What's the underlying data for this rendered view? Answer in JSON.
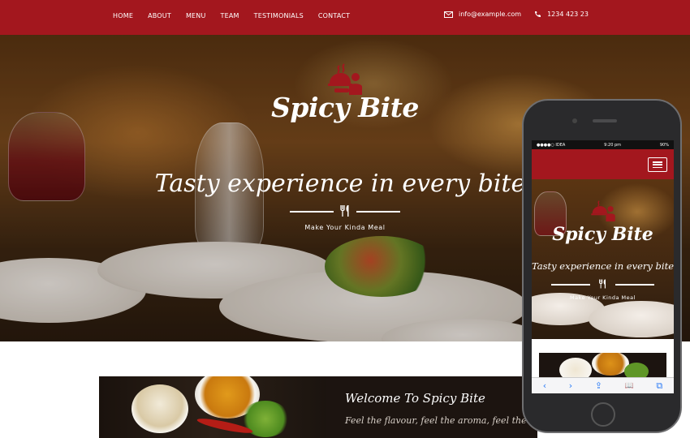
{
  "nav": {
    "links": [
      "HOME",
      "ABOUT",
      "MENU",
      "TEAM",
      "TESTIMONIALS",
      "CONTACT"
    ],
    "email": "info@example.com",
    "phone": "1234 423 23",
    "email_icon": "envelope-icon",
    "phone_icon": "phone-icon",
    "bg_color": "#a3171e"
  },
  "hero": {
    "logo_icon": "chef-serving-icon",
    "brand": "Spicy Bite",
    "tagline": "Tasty experience in every bite!",
    "divider_icon": "fork-knife-icon",
    "subtitle": "Make Your Kinda Meal"
  },
  "welcome": {
    "title": "Welcome To Spicy Bite",
    "subtitle": "Feel the flavour, feel the aroma, feel the taste in"
  },
  "phone": {
    "status_carrier": "●●●●○ IDEA",
    "status_time": "9:20 pm",
    "status_battery": "90%",
    "brand": "Spicy Bite",
    "tagline": "Tasty experience in every bite!",
    "subtitle": "Make Your Kinda Meal",
    "menu_icon": "hamburger-menu-icon",
    "toolbar": [
      "‹",
      "›",
      "⇪",
      "📖",
      "⧉"
    ]
  }
}
